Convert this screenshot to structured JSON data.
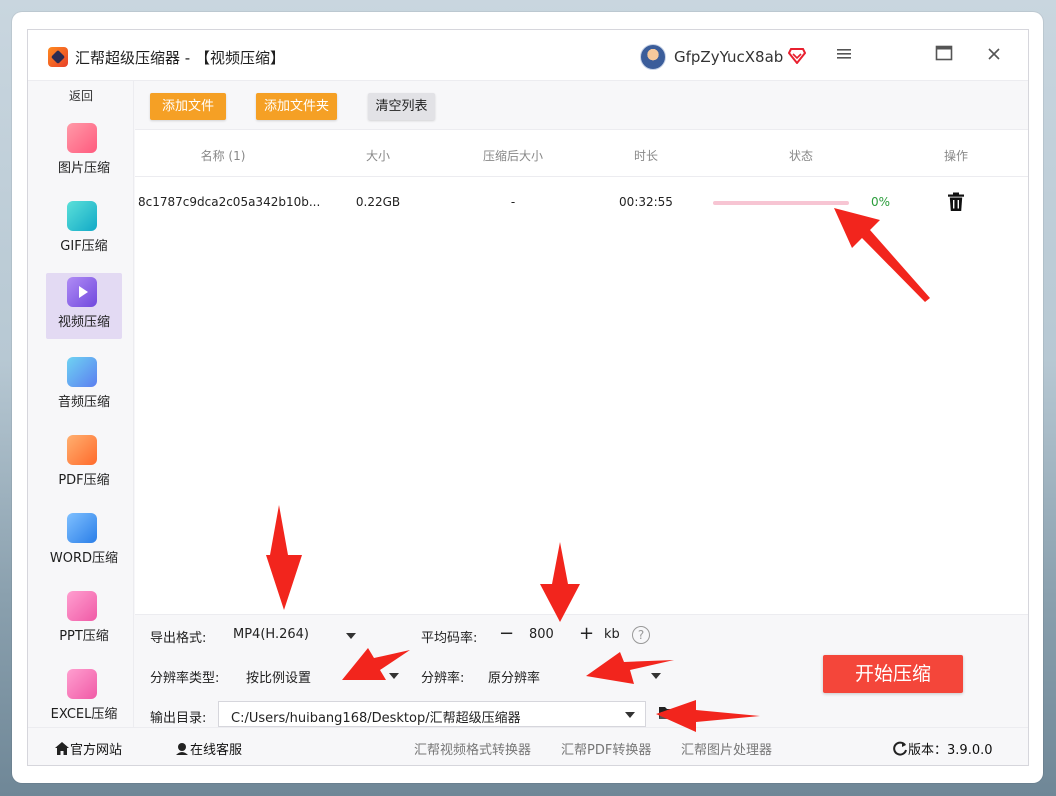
{
  "window": {
    "app_name": "汇帮超级压缩器",
    "section_title": " - 【视频压缩】",
    "username": "GfpZyYucX8ab"
  },
  "sidebar": {
    "back_label": "返回",
    "items": [
      {
        "label": "图片压缩",
        "color": "#ff6b8f"
      },
      {
        "label": "GIF压缩",
        "color": "#22c0cf"
      },
      {
        "label": "视频压缩",
        "color": "#8a6ae8",
        "active": true
      },
      {
        "label": "音频压缩",
        "color": "#3fb3e8"
      },
      {
        "label": "PDF压缩",
        "color": "#ff7a3d"
      },
      {
        "label": "WORD压缩",
        "color": "#3a8ce8"
      },
      {
        "label": "PPT压缩",
        "color": "#ff6fb4"
      },
      {
        "label": "EXCEL压缩",
        "color": "#ff6fb4"
      }
    ]
  },
  "toolbar": {
    "add_file": "添加文件",
    "add_folder": "添加文件夹",
    "clear_list": "清空列表"
  },
  "table": {
    "headers": {
      "name": "名称 (1)",
      "size": "大小",
      "compressed_size": "压缩后大小",
      "duration": "时长",
      "status": "状态",
      "action": "操作"
    },
    "rows": [
      {
        "name": "8c1787c9dca2c05a342b10b...",
        "size": "0.22GB",
        "compressed_size": "-",
        "duration": "00:32:55",
        "progress_percent": 0,
        "progress_text": "0%"
      }
    ]
  },
  "settings": {
    "format_label": "导出格式:",
    "format_value": "MP4(H.264)",
    "bitrate_label": "平均码率:",
    "bitrate_minus": "−",
    "bitrate_value": "800",
    "bitrate_plus": "+",
    "bitrate_unit": "kb",
    "help_glyph": "?",
    "res_type_label": "分辨率类型:",
    "res_type_value": "按比例设置",
    "resolution_label": "分辨率:",
    "resolution_value": "原分辨率",
    "output_label": "输出目录:",
    "output_value": "C:/Users/huibang168/Desktop/汇帮超级压缩器",
    "start_button": "开始压缩"
  },
  "footer": {
    "website": "官方网站",
    "support": "在线客服",
    "link1": "汇帮视频格式转换器",
    "link2": "汇帮PDF转换器",
    "link3": "汇帮图片处理器",
    "version_label": "版本：",
    "version_value": "3.9.0.0"
  },
  "colors": {
    "accent_orange": "#f5a025",
    "start_red": "#f4463a",
    "arrow_red": "#f2251d",
    "progress_green": "#2a9d3b"
  }
}
